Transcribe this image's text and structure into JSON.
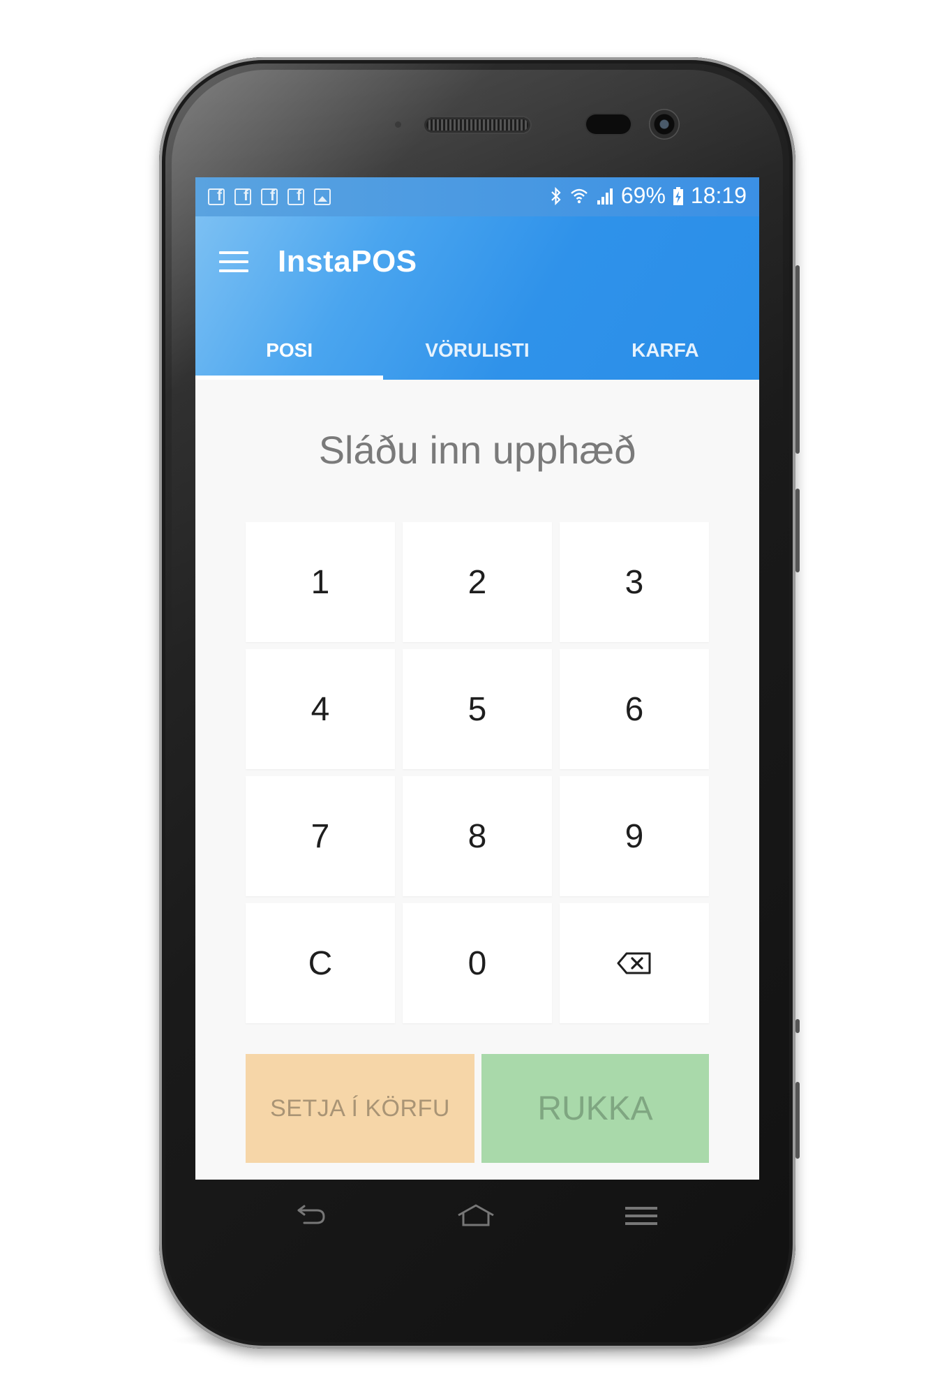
{
  "status_bar": {
    "notification_icons": [
      "facebook-icon",
      "facebook-icon",
      "facebook-icon",
      "facebook-icon",
      "image-icon"
    ],
    "system_icons": [
      "bluetooth-icon",
      "wifi-icon",
      "signal-icon",
      "battery-charging-icon"
    ],
    "battery": "69%",
    "time": "18:19"
  },
  "app_bar": {
    "menu_icon": "hamburger-menu-icon",
    "title": "InstaPOS"
  },
  "tabs": [
    {
      "label": "POSI",
      "active": true
    },
    {
      "label": "VÖRULISTI",
      "active": false
    },
    {
      "label": "KARFA",
      "active": false
    }
  ],
  "main": {
    "prompt": "Sláðu inn upphæð",
    "keys": [
      "1",
      "2",
      "3",
      "4",
      "5",
      "6",
      "7",
      "8",
      "9",
      "C",
      "0"
    ],
    "backspace_icon": "backspace-icon",
    "add_to_cart_label": "SETJA Í KÖRFU",
    "charge_label": "RUKKA"
  },
  "nav_bar": {
    "icons": [
      "back-icon",
      "home-icon",
      "menu-icon"
    ]
  },
  "colors": {
    "primary": "#2a8ee8",
    "cart_button": "#f6d6a8",
    "charge_button": "#a9d9aa"
  }
}
